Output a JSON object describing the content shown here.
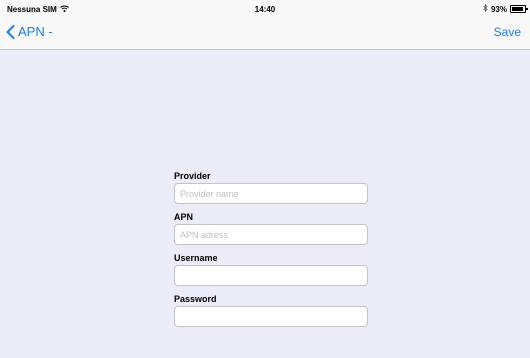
{
  "status_bar": {
    "carrier": "Nessuna SIM",
    "wifi_icon": "wifi-icon",
    "time": "14:40",
    "bluetooth_icon": "bluetooth-icon",
    "battery_percent": "93%",
    "battery_level": 0.93
  },
  "navbar": {
    "back_label": "APN -",
    "save_label": "Save",
    "accent_color": "#1a7ef5"
  },
  "form": {
    "provider": {
      "label": "Provider",
      "placeholder": "Provider name",
      "value": ""
    },
    "apn": {
      "label": "APN",
      "placeholder": "APN adress",
      "value": ""
    },
    "username": {
      "label": "Username",
      "placeholder": "",
      "value": ""
    },
    "password": {
      "label": "Password",
      "placeholder": "",
      "value": ""
    }
  }
}
